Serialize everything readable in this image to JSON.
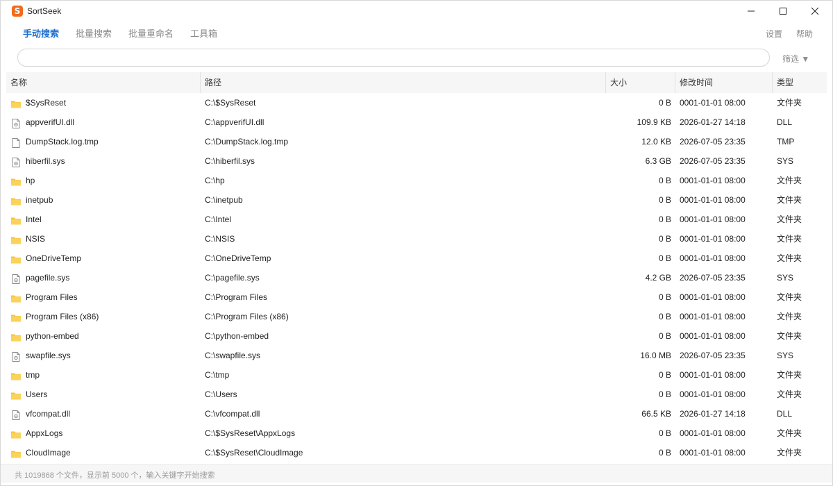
{
  "window": {
    "title": "SortSeek",
    "logo_letter": "S"
  },
  "nav": {
    "tabs": [
      {
        "label": "手动搜索",
        "active": true
      },
      {
        "label": "批量搜索",
        "active": false
      },
      {
        "label": "批量重命名",
        "active": false
      },
      {
        "label": "工具箱",
        "active": false
      }
    ],
    "settings_label": "设置",
    "help_label": "帮助"
  },
  "search": {
    "value": "",
    "placeholder": "",
    "filter_label": "筛选 ▼"
  },
  "table": {
    "columns": [
      "名称",
      "路径",
      "大小",
      "修改时间",
      "类型"
    ],
    "rows": [
      {
        "icon": "folder-icon",
        "name": "$SysReset",
        "path": "C:\\$SysReset",
        "size": "0 B",
        "modified": "0001-01-01 08:00",
        "type": "文件夹"
      },
      {
        "icon": "system-file-icon",
        "name": "appverifUI.dll",
        "path": "C:\\appverifUI.dll",
        "size": "109.9 KB",
        "modified": "2026-01-27 14:18",
        "type": "DLL"
      },
      {
        "icon": "file-icon",
        "name": "DumpStack.log.tmp",
        "path": "C:\\DumpStack.log.tmp",
        "size": "12.0 KB",
        "modified": "2026-07-05 23:35",
        "type": "TMP"
      },
      {
        "icon": "system-file-icon",
        "name": "hiberfil.sys",
        "path": "C:\\hiberfil.sys",
        "size": "6.3 GB",
        "modified": "2026-07-05 23:35",
        "type": "SYS"
      },
      {
        "icon": "folder-icon",
        "name": "hp",
        "path": "C:\\hp",
        "size": "0 B",
        "modified": "0001-01-01 08:00",
        "type": "文件夹"
      },
      {
        "icon": "folder-icon",
        "name": "inetpub",
        "path": "C:\\inetpub",
        "size": "0 B",
        "modified": "0001-01-01 08:00",
        "type": "文件夹"
      },
      {
        "icon": "folder-icon",
        "name": "Intel",
        "path": "C:\\Intel",
        "size": "0 B",
        "modified": "0001-01-01 08:00",
        "type": "文件夹"
      },
      {
        "icon": "folder-icon",
        "name": "NSIS",
        "path": "C:\\NSIS",
        "size": "0 B",
        "modified": "0001-01-01 08:00",
        "type": "文件夹"
      },
      {
        "icon": "folder-icon",
        "name": "OneDriveTemp",
        "path": "C:\\OneDriveTemp",
        "size": "0 B",
        "modified": "0001-01-01 08:00",
        "type": "文件夹"
      },
      {
        "icon": "system-file-icon",
        "name": "pagefile.sys",
        "path": "C:\\pagefile.sys",
        "size": "4.2 GB",
        "modified": "2026-07-05 23:35",
        "type": "SYS"
      },
      {
        "icon": "folder-icon",
        "name": "Program Files",
        "path": "C:\\Program Files",
        "size": "0 B",
        "modified": "0001-01-01 08:00",
        "type": "文件夹"
      },
      {
        "icon": "folder-icon",
        "name": "Program Files (x86)",
        "path": "C:\\Program Files (x86)",
        "size": "0 B",
        "modified": "0001-01-01 08:00",
        "type": "文件夹"
      },
      {
        "icon": "folder-icon",
        "name": "python-embed",
        "path": "C:\\python-embed",
        "size": "0 B",
        "modified": "0001-01-01 08:00",
        "type": "文件夹"
      },
      {
        "icon": "system-file-icon",
        "name": "swapfile.sys",
        "path": "C:\\swapfile.sys",
        "size": "16.0 MB",
        "modified": "2026-07-05 23:35",
        "type": "SYS"
      },
      {
        "icon": "folder-icon",
        "name": "tmp",
        "path": "C:\\tmp",
        "size": "0 B",
        "modified": "0001-01-01 08:00",
        "type": "文件夹"
      },
      {
        "icon": "folder-icon",
        "name": "Users",
        "path": "C:\\Users",
        "size": "0 B",
        "modified": "0001-01-01 08:00",
        "type": "文件夹"
      },
      {
        "icon": "system-file-icon",
        "name": "vfcompat.dll",
        "path": "C:\\vfcompat.dll",
        "size": "66.5 KB",
        "modified": "2026-01-27 14:18",
        "type": "DLL"
      },
      {
        "icon": "folder-icon",
        "name": "AppxLogs",
        "path": "C:\\$SysReset\\AppxLogs",
        "size": "0 B",
        "modified": "0001-01-01 08:00",
        "type": "文件夹"
      },
      {
        "icon": "folder-icon",
        "name": "CloudImage",
        "path": "C:\\$SysReset\\CloudImage",
        "size": "0 B",
        "modified": "0001-01-01 08:00",
        "type": "文件夹"
      }
    ]
  },
  "status": {
    "text": "共 1019868 个文件，显示前 5000 个，输入关键字开始搜索"
  },
  "colors": {
    "accent": "#1f6fd1",
    "folder": "#f7c23d",
    "logo": "#f26a1b"
  }
}
